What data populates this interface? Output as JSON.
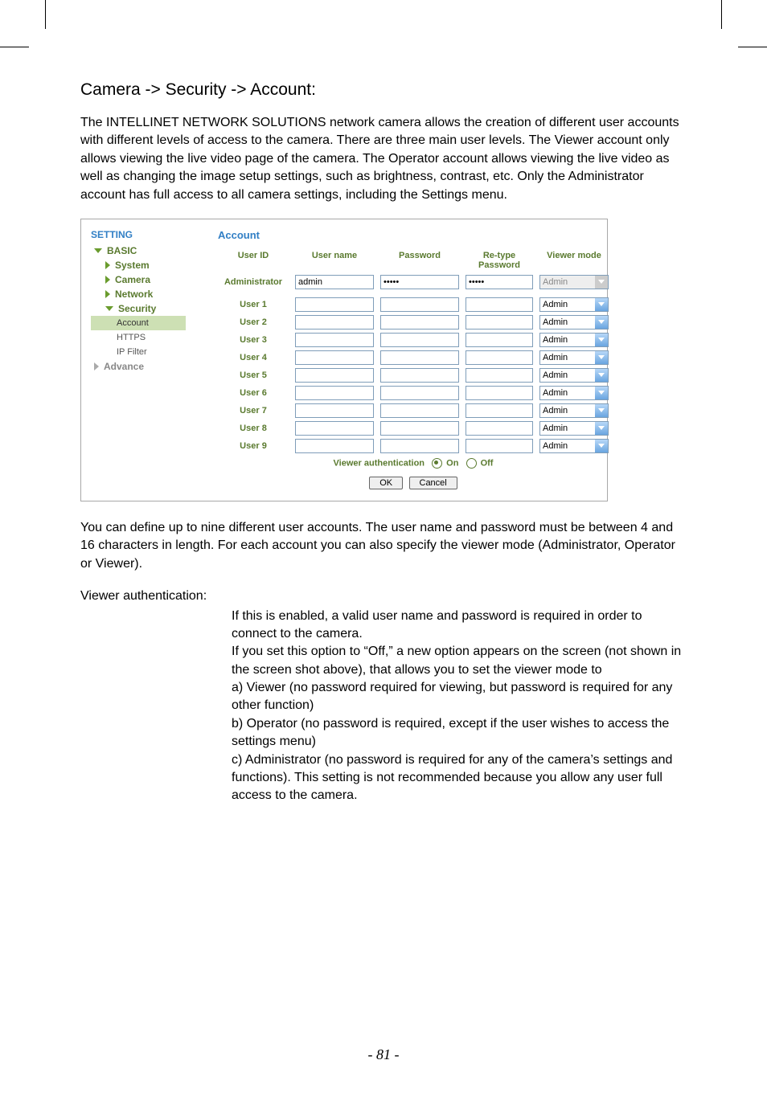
{
  "heading": "Camera -> Security -> Account:",
  "intro": "The INTELLINET NETWORK SOLUTIONS network camera allows the creation of different user accounts with different levels of access to the camera. There are three main user levels. The Viewer account only allows viewing the live video page of the camera. The Operator account allows viewing the live video as well as changing the image setup settings, such as brightness, contrast, etc. Only the Administrator account has full access to all camera settings, including the Settings menu.",
  "sidebar": {
    "setting": "SETTING",
    "basic": "BASIC",
    "system": "System",
    "camera": "Camera",
    "network": "Network",
    "security": "Security",
    "account": "Account",
    "https": "HTTPS",
    "ipfilter": "IP Filter",
    "advance": "Advance"
  },
  "panel": {
    "title": "Account",
    "cols": {
      "userid": "User ID",
      "username": "User name",
      "password": "Password",
      "retype": "Re-type\nPassword",
      "viewer": "Viewer mode"
    },
    "rows": [
      {
        "id": "Administrator",
        "username": "admin",
        "password": "•••••",
        "retype": "•••••",
        "mode": "Admin",
        "disabled": true
      },
      {
        "id": "User 1",
        "username": "",
        "password": "",
        "retype": "",
        "mode": "Admin",
        "disabled": false
      },
      {
        "id": "User 2",
        "username": "",
        "password": "",
        "retype": "",
        "mode": "Admin",
        "disabled": false
      },
      {
        "id": "User 3",
        "username": "",
        "password": "",
        "retype": "",
        "mode": "Admin",
        "disabled": false
      },
      {
        "id": "User 4",
        "username": "",
        "password": "",
        "retype": "",
        "mode": "Admin",
        "disabled": false
      },
      {
        "id": "User 5",
        "username": "",
        "password": "",
        "retype": "",
        "mode": "Admin",
        "disabled": false
      },
      {
        "id": "User 6",
        "username": "",
        "password": "",
        "retype": "",
        "mode": "Admin",
        "disabled": false
      },
      {
        "id": "User 7",
        "username": "",
        "password": "",
        "retype": "",
        "mode": "Admin",
        "disabled": false
      },
      {
        "id": "User 8",
        "username": "",
        "password": "",
        "retype": "",
        "mode": "Admin",
        "disabled": false
      },
      {
        "id": "User 9",
        "username": "",
        "password": "",
        "retype": "",
        "mode": "Admin",
        "disabled": false
      }
    ],
    "authlabel": "Viewer authentication",
    "on": "On",
    "off": "Off",
    "ok": "OK",
    "cancel": "Cancel"
  },
  "after": "You can define up to nine different user accounts. The user name and password must be between 4 and 16 characters in length. For each account you can also specify the viewer mode (Administrator, Operator or Viewer).",
  "dt": "Viewer authentication:",
  "dd1": "If this is enabled, a valid user name and password is required in order to connect to the camera.",
  "dd2": "If you set this option to “Off,” a new option appears on the screen (not shown in the screen shot above), that allows you to set the viewer mode to",
  "dd3": "a) Viewer (no password required for viewing, but password is required for any other function)",
  "dd4": "b) Operator (no password is required, except if the user wishes to access the settings menu)",
  "dd5": "c) Administrator (no password is required for any of the camera’s settings and functions). This setting is not recommended because you allow any user full access to the camera.",
  "footer": "- 81 -"
}
